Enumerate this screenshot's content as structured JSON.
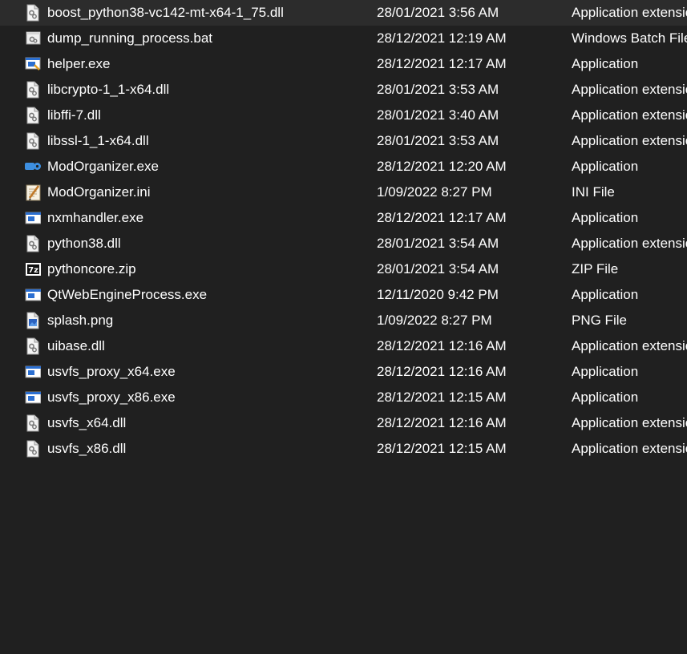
{
  "files": [
    {
      "name": "boost_python38-vc142-mt-x64-1_75.dll",
      "date": "28/01/2021 3:56 AM",
      "type": "Application extension",
      "icon": "dll-file-icon"
    },
    {
      "name": "dump_running_process.bat",
      "date": "28/12/2021 12:19 AM",
      "type": "Windows Batch File",
      "icon": "batch-file-icon"
    },
    {
      "name": "helper.exe",
      "date": "28/12/2021 12:17 AM",
      "type": "Application",
      "icon": "helper-app-icon"
    },
    {
      "name": "libcrypto-1_1-x64.dll",
      "date": "28/01/2021 3:53 AM",
      "type": "Application extension",
      "icon": "dll-file-icon"
    },
    {
      "name": "libffi-7.dll",
      "date": "28/01/2021 3:40 AM",
      "type": "Application extension",
      "icon": "dll-file-icon"
    },
    {
      "name": "libssl-1_1-x64.dll",
      "date": "28/01/2021 3:53 AM",
      "type": "Application extension",
      "icon": "dll-file-icon"
    },
    {
      "name": "ModOrganizer.exe",
      "date": "28/12/2021 12:20 AM",
      "type": "Application",
      "icon": "modorganizer-icon"
    },
    {
      "name": "ModOrganizer.ini",
      "date": "1/09/2022 8:27 PM",
      "type": "INI File",
      "icon": "ini-file-icon"
    },
    {
      "name": "nxmhandler.exe",
      "date": "28/12/2021 12:17 AM",
      "type": "Application",
      "icon": "exe-window-icon"
    },
    {
      "name": "python38.dll",
      "date": "28/01/2021 3:54 AM",
      "type": "Application extension",
      "icon": "dll-file-icon"
    },
    {
      "name": "pythoncore.zip",
      "date": "28/01/2021 3:54 AM",
      "type": "ZIP File",
      "icon": "7zip-archive-icon"
    },
    {
      "name": "QtWebEngineProcess.exe",
      "date": "12/11/2020 9:42 PM",
      "type": "Application",
      "icon": "exe-window-icon"
    },
    {
      "name": "splash.png",
      "date": "1/09/2022 8:27 PM",
      "type": "PNG File",
      "icon": "png-image-icon"
    },
    {
      "name": "uibase.dll",
      "date": "28/12/2021 12:16 AM",
      "type": "Application extension",
      "icon": "dll-file-icon"
    },
    {
      "name": "usvfs_proxy_x64.exe",
      "date": "28/12/2021 12:16 AM",
      "type": "Application",
      "icon": "exe-window-icon"
    },
    {
      "name": "usvfs_proxy_x86.exe",
      "date": "28/12/2021 12:15 AM",
      "type": "Application",
      "icon": "exe-window-icon"
    },
    {
      "name": "usvfs_x64.dll",
      "date": "28/12/2021 12:16 AM",
      "type": "Application extension",
      "icon": "dll-file-icon"
    },
    {
      "name": "usvfs_x86.dll",
      "date": "28/12/2021 12:15 AM",
      "type": "Application extension",
      "icon": "dll-file-icon"
    }
  ],
  "colors": {
    "background": "#202020",
    "text": "#ffffff",
    "exe_blue": "#2b6fd1",
    "modorganizer_blue": "#3d8fe0"
  }
}
